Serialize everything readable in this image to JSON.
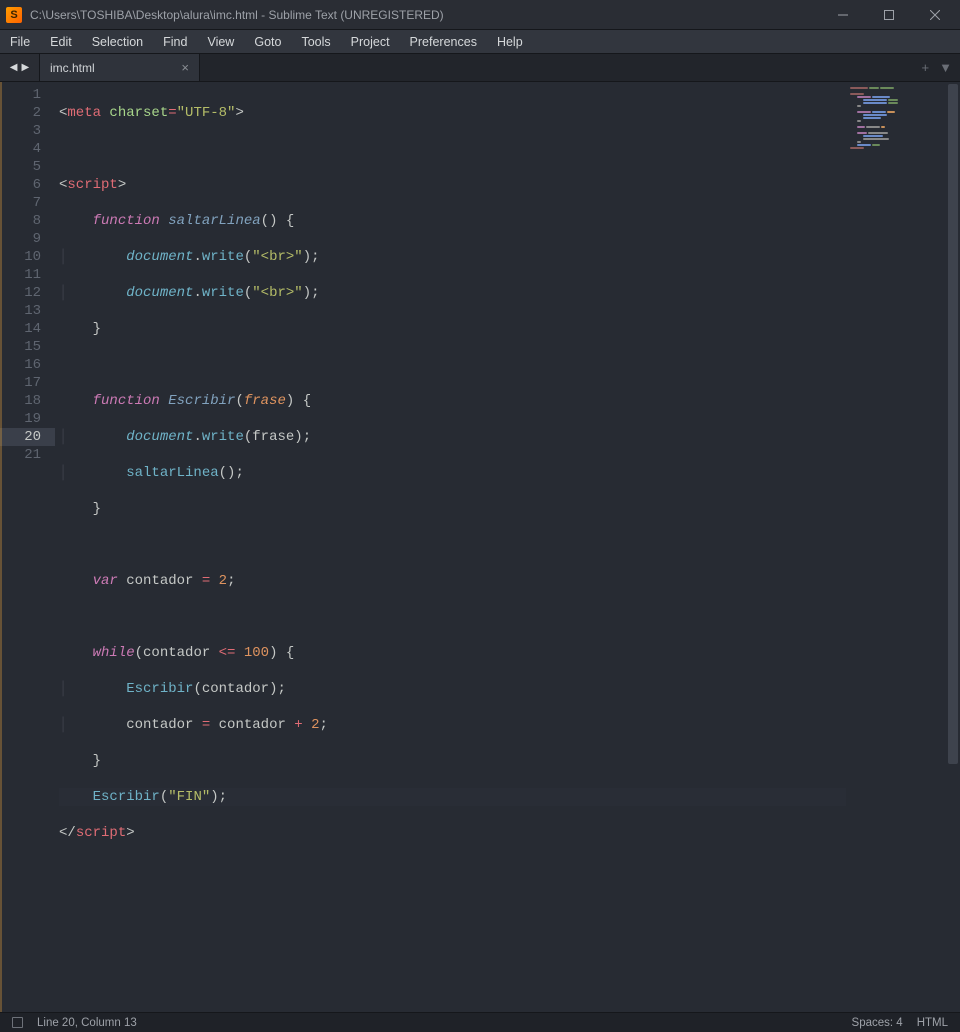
{
  "window": {
    "title": "C:\\Users\\TOSHIBA\\Desktop\\alura\\imc.html - Sublime Text (UNREGISTERED)",
    "app_icon_letter": "S"
  },
  "menu": [
    "File",
    "Edit",
    "Selection",
    "Find",
    "View",
    "Goto",
    "Tools",
    "Project",
    "Preferences",
    "Help"
  ],
  "tabs": {
    "nav_back": "◀",
    "nav_fwd": "▶",
    "active": {
      "label": "imc.html",
      "close": "×"
    },
    "right_plus": "+",
    "right_more": "▼"
  },
  "lines": [
    "1",
    "2",
    "3",
    "4",
    "5",
    "6",
    "7",
    "8",
    "9",
    "10",
    "11",
    "12",
    "13",
    "14",
    "15",
    "16",
    "17",
    "18",
    "19",
    "20",
    "21"
  ],
  "current_line_index": 19,
  "code": {
    "l1": {
      "a": "<",
      "b": "meta",
      "c": " ",
      "d": "charset",
      "e": "=",
      "f": "\"UTF-8\"",
      "g": ">"
    },
    "l3": {
      "a": "<",
      "b": "script",
      "c": ">"
    },
    "l4": {
      "ind": "    ",
      "kw": "function",
      "sp": " ",
      "name": "saltarLinea",
      "p1": "(",
      "p2": ")",
      "sp2": " ",
      "b": "{"
    },
    "l5": {
      "ind": "        ",
      "obj": "document",
      "dot": ".",
      "fn": "write",
      "p1": "(",
      "s": "\"<br>\"",
      "p2": ")",
      "semi": ";"
    },
    "l6": {
      "ind": "        ",
      "obj": "document",
      "dot": ".",
      "fn": "write",
      "p1": "(",
      "s": "\"<br>\"",
      "p2": ")",
      "semi": ";"
    },
    "l7": {
      "ind": "    ",
      "b": "}"
    },
    "l9": {
      "ind": "    ",
      "kw": "function",
      "sp": " ",
      "name": "Escribir",
      "p1": "(",
      "param": "frase",
      "p2": ")",
      "sp2": " ",
      "b": "{"
    },
    "l10": {
      "ind": "        ",
      "obj": "document",
      "dot": ".",
      "fn": "write",
      "p1": "(",
      "arg": "frase",
      "p2": ")",
      "semi": ";"
    },
    "l11": {
      "ind": "        ",
      "fn": "saltarLinea",
      "p1": "(",
      "p2": ")",
      "semi": ";"
    },
    "l12": {
      "ind": "    ",
      "b": "}"
    },
    "l14": {
      "ind": "    ",
      "kw": "var",
      "sp": " ",
      "id": "contador",
      "sp2": " ",
      "op": "=",
      "sp3": " ",
      "num": "2",
      "semi": ";"
    },
    "l16": {
      "ind": "    ",
      "kw": "while",
      "p1": "(",
      "id": "contador",
      "sp": " ",
      "op": "<=",
      "sp2": " ",
      "num": "100",
      "p2": ")",
      "sp3": " ",
      "b": "{"
    },
    "l17": {
      "ind": "        ",
      "fn": "Escribir",
      "p1": "(",
      "arg": "contador",
      "p2": ")",
      "semi": ";"
    },
    "l18": {
      "ind": "        ",
      "id": "contador",
      "sp": " ",
      "op": "=",
      "sp2": " ",
      "id2": "contador",
      "sp3": " ",
      "op2": "+",
      "sp4": " ",
      "num": "2",
      "semi": ";"
    },
    "l19": {
      "ind": "    ",
      "b": "}"
    },
    "l20": {
      "ind": "    ",
      "fn": "Escribir",
      "p1": "(",
      "s": "\"FIN\"",
      "p2": ")",
      "semi": ";"
    },
    "l21": {
      "a": "</",
      "b": "script",
      "c": ">"
    }
  },
  "status": {
    "position": "Line 20, Column 13",
    "spaces": "Spaces: 4",
    "lang": "HTML"
  }
}
